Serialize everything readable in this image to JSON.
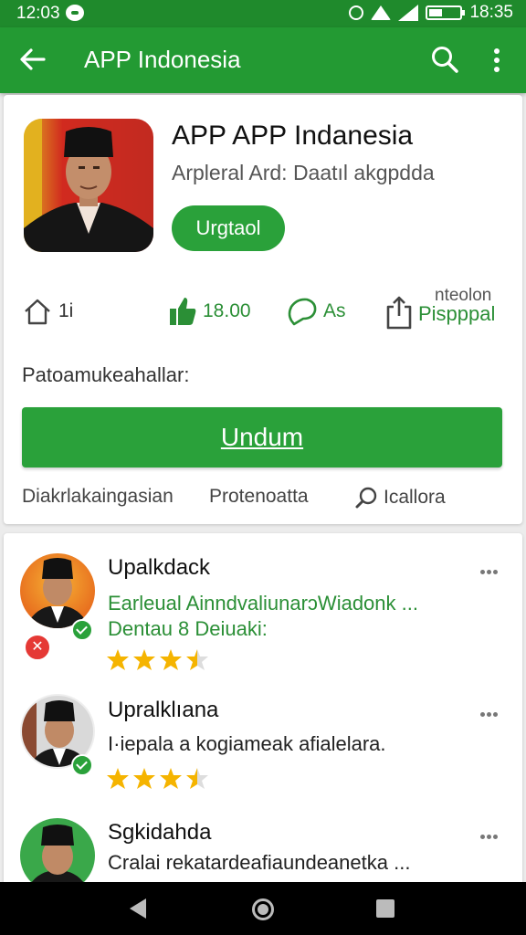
{
  "status_bar": {
    "time_left": "12:03",
    "time_right": "18:35"
  },
  "app_bar": {
    "title": "APP Indonesia"
  },
  "app": {
    "name": "APP APP Indanesia",
    "subtitle": "Arpleral Ard: Daatıl akgpdda",
    "install_label": "Urgtaol"
  },
  "stats": [
    {
      "icon": "home-icon",
      "value": "1i"
    },
    {
      "icon": "thumb-up-icon",
      "value": "18.00"
    },
    {
      "icon": "chat-icon",
      "value": "As"
    },
    {
      "icon": "share-icon",
      "top": "nteolon",
      "value": "Pispppal"
    }
  ],
  "section_label": "Patoamukeahallar:",
  "main_button_label": "Undum",
  "footer_links": [
    "Diakrlakaingasian",
    "Protenoatta",
    "Icallora"
  ],
  "reviews": [
    {
      "name": "Upalkdack",
      "lines": [
        "Earleual AinndvaliunarɔWiadonk ...",
        "Dentau 8 Deiuaki:"
      ],
      "rating": 3.5
    },
    {
      "name": "Upralklıana",
      "lines": [
        "I·iepala a kogiameak afialelara."
      ],
      "rating": 3.5
    },
    {
      "name": "Sgkidahda",
      "lines": [
        "Cralai rekatardeafiaundeanetka ..."
      ],
      "rating": 0
    }
  ],
  "colors": {
    "primary": "#239a33",
    "status_bar": "#1f8a2c",
    "accent_text": "#2b8f36",
    "star": "#f5b400"
  }
}
